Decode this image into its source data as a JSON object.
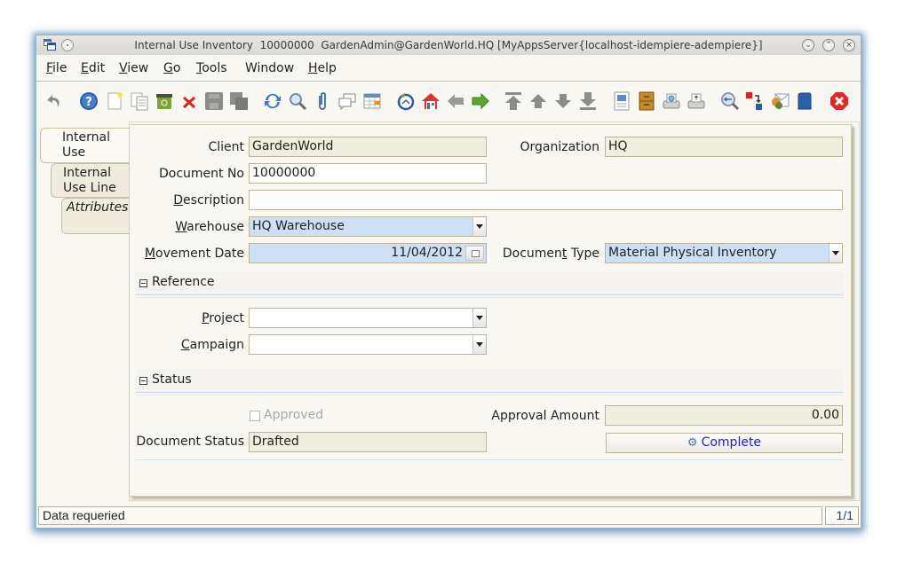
{
  "window": {
    "title": "Internal Use Inventory  10000000  GardenAdmin@GardenWorld.HQ [MyAppsServer{localhost-idempiere-adempiere}]",
    "controls": [
      "minimize",
      "maximize",
      "close"
    ]
  },
  "menu": {
    "items": [
      {
        "label": "File",
        "mnemonic": "F",
        "rest": "ile"
      },
      {
        "label": "Edit",
        "mnemonic": "E",
        "rest": "dit"
      },
      {
        "label": "View",
        "mnemonic": "V",
        "rest": "iew"
      },
      {
        "label": "Go",
        "mnemonic": "G",
        "rest": "o"
      },
      {
        "label": "Tools",
        "mnemonic": "T",
        "rest": "ools"
      },
      {
        "label": "Window",
        "mnemonic": "",
        "rest": "Window"
      },
      {
        "label": "Help",
        "mnemonic": "H",
        "rest": "elp"
      }
    ]
  },
  "toolbar": {
    "buttons": [
      "undo-icon",
      "help-icon",
      "new-record-icon",
      "copy-record-icon",
      "delete-icon",
      "delete-selection-icon",
      "save-icon",
      "save-new-icon",
      "refresh-icon",
      "find-icon",
      "attachment-icon",
      "chat-icon",
      "grid-toggle-icon",
      "history-icon",
      "home-icon",
      "previous-record-icon",
      "next-record-icon",
      "first-record-icon",
      "parent-record-icon",
      "detail-record-icon",
      "last-record-icon",
      "report-icon",
      "archive-icon",
      "print-preview-icon",
      "print-icon",
      "zoom-across-icon",
      "workflow-icon",
      "request-icon",
      "product-info-icon",
      "close-window-icon"
    ]
  },
  "tabs": [
    {
      "label": "Internal Use",
      "active": true
    },
    {
      "label": "Internal Use Line",
      "active": false
    },
    {
      "label": "Attributes",
      "active": false
    }
  ],
  "form": {
    "client": {
      "label": "Client",
      "value": "GardenWorld"
    },
    "organization": {
      "label": "Organization",
      "value": "HQ"
    },
    "document_no": {
      "label": "Document No",
      "value": "10000000"
    },
    "description": {
      "label_m": "D",
      "label_rest": "escription",
      "value": ""
    },
    "warehouse": {
      "label_m": "W",
      "label_rest": "arehouse",
      "value": "HQ Warehouse"
    },
    "movement_date": {
      "label_m": "M",
      "label_rest": "ovement Date",
      "value": "11/04/2012"
    },
    "document_type": {
      "label_pre": "Documen",
      "label_m": "t",
      "label_rest": " Type",
      "value": "Material Physical Inventory"
    },
    "reference_section": "Reference",
    "project": {
      "label_m": "P",
      "label_rest": "roject",
      "value": ""
    },
    "campaign": {
      "label_m": "C",
      "label_rest": "ampaign",
      "value": ""
    },
    "status_section": "Status",
    "approved": {
      "label": "Approved",
      "checked": false
    },
    "approval_amount": {
      "label": "Approval Amount",
      "value": "0.00"
    },
    "document_status": {
      "label": "Document Status",
      "value": "Drafted"
    },
    "complete_button": "Complete"
  },
  "status_bar": {
    "message": "Data requeried",
    "record_count": "1/1"
  }
}
